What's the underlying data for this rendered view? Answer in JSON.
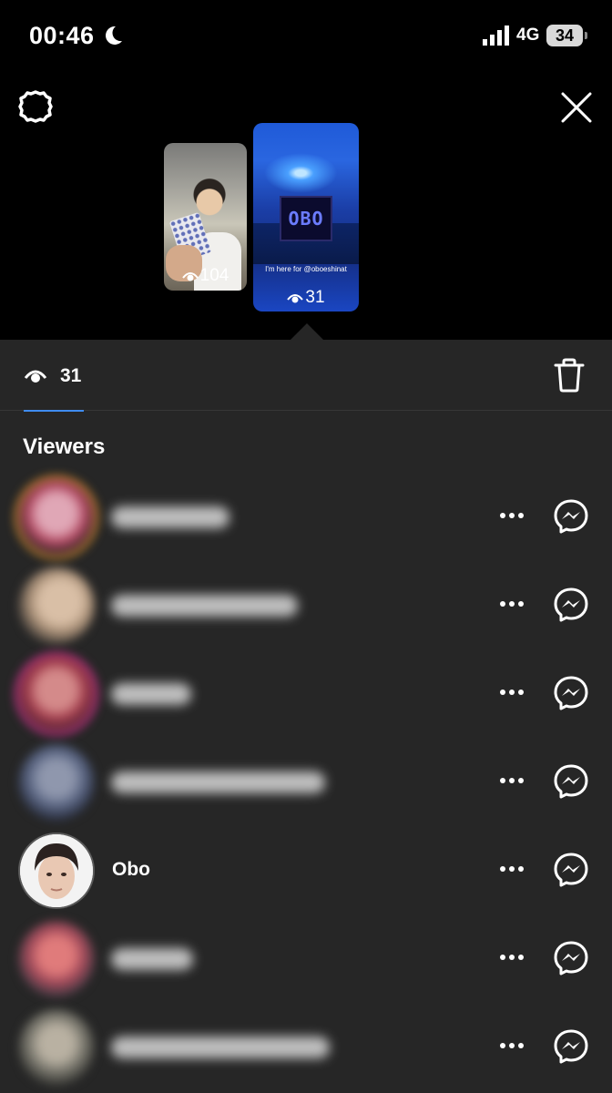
{
  "status_bar": {
    "time": "00:46",
    "network": "4G",
    "battery": "34"
  },
  "icons": {
    "settings": "settings-gear-icon",
    "close": "close-icon",
    "eye": "eye-icon",
    "trash": "trash-icon",
    "more": "more-horizontal-icon",
    "messenger": "messenger-icon",
    "moon": "moon-icon",
    "signal": "signal-icon"
  },
  "stories": [
    {
      "view_count": "104"
    },
    {
      "view_count": "31",
      "caption": "I'm here for @oboeshinat",
      "sign_text": "OBO",
      "selected": true
    }
  ],
  "sheet": {
    "views_tab_count": "31",
    "section_title": "Viewers"
  },
  "viewers": [
    {
      "name": "",
      "blurred": true
    },
    {
      "name": "",
      "blurred": true
    },
    {
      "name": "",
      "blurred": true
    },
    {
      "name": "",
      "blurred": true
    },
    {
      "name": "Obo",
      "blurred": false
    },
    {
      "name": "",
      "blurred": true
    },
    {
      "name": "",
      "blurred": true
    }
  ],
  "colors": {
    "background": "#000000",
    "sheet": "#262626",
    "accent_underline": "#3f8cf0",
    "text": "#ffffff"
  }
}
